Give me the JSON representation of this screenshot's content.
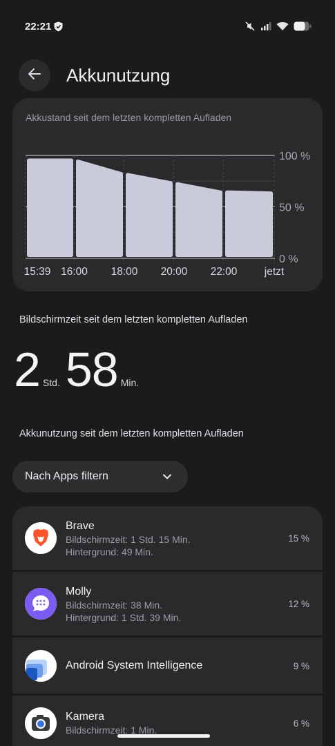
{
  "status": {
    "time": "22:21",
    "icons": [
      "shield-icon",
      "mute-icon",
      "signal-icon",
      "wifi-icon",
      "battery-icon"
    ]
  },
  "header": {
    "title": "Akkunutzung",
    "back_icon": "arrow-left-icon"
  },
  "battery_chart": {
    "title": "Akkustand seit dem letzten kompletten Aufladen",
    "chart_data": {
      "type": "area",
      "title": "Akkustand seit dem letzten kompletten Aufladen",
      "y_ticks": [
        "100 %",
        "50 %",
        "0 %"
      ],
      "ylim": [
        0,
        100
      ],
      "x_ticks": [
        "15:39",
        "16:00",
        "18:00",
        "20:00",
        "22:00",
        "jetzt"
      ],
      "bars": [
        {
          "start": "15:39",
          "end": "16:00",
          "level_start": 97,
          "level_end": 97
        },
        {
          "start": "16:00",
          "end": "18:00",
          "level_start": 96,
          "level_end": 84
        },
        {
          "start": "18:00",
          "end": "20:00",
          "level_start": 83,
          "level_end": 75
        },
        {
          "start": "20:00",
          "end": "22:00",
          "level_start": 74,
          "level_end": 66
        },
        {
          "start": "22:00",
          "end": "jetzt",
          "level_start": 66,
          "level_end": 65
        }
      ],
      "fill_color": "#c9cbdb",
      "grid": true
    }
  },
  "screen_time": {
    "label": "Bildschirmzeit seit dem letzten kompletten Aufladen",
    "hours": "2",
    "hours_unit": "Std.",
    "minutes": "58",
    "minutes_unit": "Min."
  },
  "usage": {
    "label": "Akkunutzung seit dem letzten kompletten Aufladen",
    "filter_label": "Nach Apps filtern",
    "apps": [
      {
        "name": "Brave",
        "line1": "Bildschirmzeit: 1 Std. 15 Min.",
        "line2": "Hintergrund: 49 Min.",
        "percent": "15 %",
        "icon": "brave-lion-icon"
      },
      {
        "name": "Molly",
        "line1": "Bildschirmzeit: 38 Min.",
        "line2": "Hintergrund: 1 Std. 39 Min.",
        "percent": "12 %",
        "icon": "molly-chat-icon"
      },
      {
        "name": "Android System Intelligence",
        "percent": "9 %",
        "icon": "android-system-intelligence-icon"
      },
      {
        "name": "Kamera",
        "line1": "Bildschirmzeit: 1 Min.",
        "percent": "6 %",
        "icon": "camera-icon"
      }
    ]
  }
}
